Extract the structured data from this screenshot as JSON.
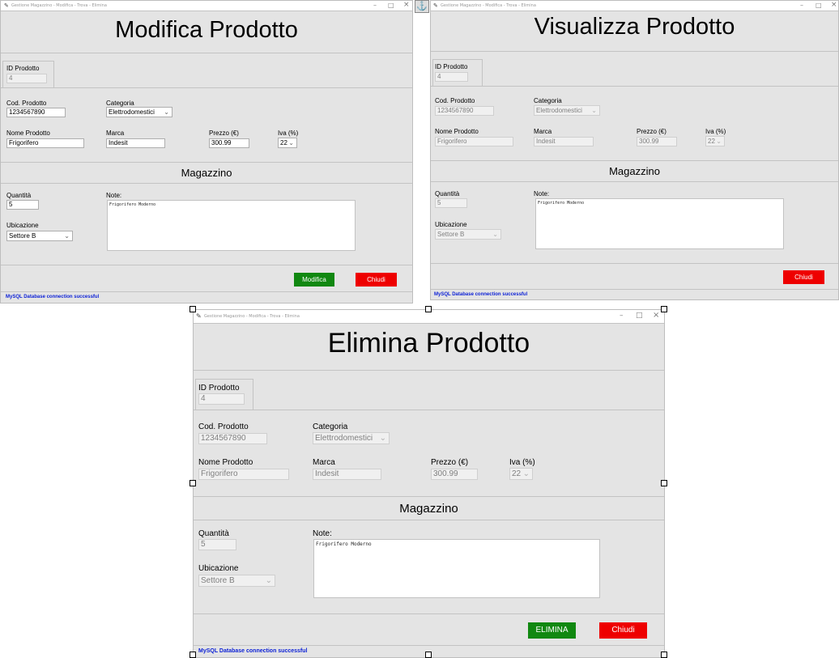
{
  "common": {
    "window_title": "Gestione Magazzino - Modifica - Trova - Elimina",
    "app_icon": "feather-icon",
    "minimize": "–",
    "maximize": "□",
    "close": "×",
    "id_label": "ID Prodotto",
    "id_value": "4",
    "cod_label": "Cod. Prodotto",
    "cod_value": "1234567890",
    "categoria_label": "Categoria",
    "categoria_value": "Elettrodomestici",
    "nome_label": "Nome Prodotto",
    "nome_value": "Frigorifero",
    "marca_label": "Marca",
    "marca_value": "Indesit",
    "prezzo_label": "Prezzo (€)",
    "prezzo_value": "300.99",
    "iva_label": "Iva (%)",
    "iva_value": "22",
    "section_magazzino": "Magazzino",
    "quantita_label": "Quantità",
    "quantita_value": "5",
    "note_label": "Note:",
    "note_value": "Frigorifero Moderno",
    "ubicazione_label": "Ubicazione",
    "ubicazione_value": "Settore B",
    "status_text": "MySQL Database connection successful",
    "chiudi_label": "Chiudi",
    "dropdown_arrow": "⌄"
  },
  "modifica": {
    "heading": "Modifica Prodotto",
    "action_label": "Modifica"
  },
  "visualizza": {
    "heading": "Visualizza Prodotto"
  },
  "elimina": {
    "heading": "Elimina Prodotto",
    "action_label": "ELIMINA"
  },
  "anchor_icon": "⚓",
  "colors": {
    "window_bg": "#e4e4e4",
    "action_green": "#118811",
    "close_red": "#ee0000",
    "status_blue": "#0a1fd6"
  }
}
